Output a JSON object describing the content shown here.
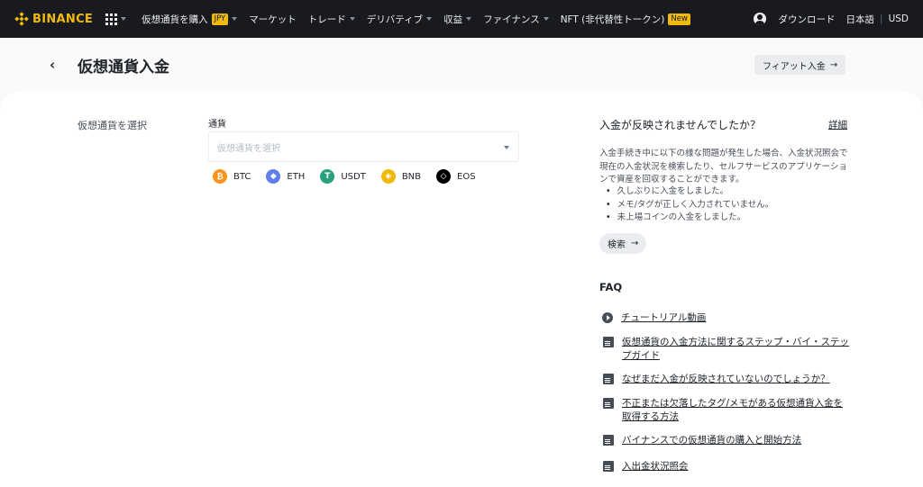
{
  "topbar": {
    "logo_text": "BINANCE",
    "brand_color": "#f0b90b",
    "nav": [
      {
        "label": "仮想通貨を購入",
        "badge": "JPY",
        "has_caret": true
      },
      {
        "label": "マーケット",
        "badge": "",
        "has_caret": false
      },
      {
        "label": "トレード",
        "badge": "",
        "has_caret": true
      },
      {
        "label": "デリバティブ",
        "badge": "",
        "has_caret": true
      },
      {
        "label": "収益",
        "badge": "",
        "has_caret": true
      },
      {
        "label": "ファイナンス",
        "badge": "",
        "has_caret": true
      },
      {
        "label": "NFT (非代替性トークン)",
        "badge": "New",
        "has_caret": false
      }
    ],
    "download_label": "ダウンロード",
    "language_label": "日本語",
    "currency_label": "USD"
  },
  "header": {
    "back_glyph": "‹",
    "title": "仮想通貨入金",
    "fiat_button_label": "フィアット入金",
    "arrow_glyph": "→"
  },
  "form": {
    "step_label": "仮想通貨を選択",
    "field_label": "通貨",
    "select_placeholder": "仮想通貨を選択",
    "coins": [
      {
        "symbol": "BTC",
        "icon": "bitcoin-icon",
        "color": "#f7931a",
        "glyph": "₿"
      },
      {
        "symbol": "ETH",
        "icon": "ethereum-icon",
        "color": "#627eea",
        "glyph": "◆"
      },
      {
        "symbol": "USDT",
        "icon": "tether-icon",
        "color": "#26a17b",
        "glyph": "T"
      },
      {
        "symbol": "BNB",
        "icon": "bnb-icon",
        "color": "#f0b90b",
        "glyph": "◈"
      },
      {
        "symbol": "EOS",
        "icon": "eos-icon",
        "color": "#000000",
        "glyph": "◇"
      }
    ]
  },
  "help": {
    "title": "入金が反映されませんでしたか？",
    "detail_link": "詳細",
    "description": "入金手続き中に以下の様な問題が発生した場合、入金状況照会で現在の入金状況を検索したり、セルフサービスのアプリケーションで資産を回収することができます。",
    "bullets": [
      "久しぶりに入金をしました。",
      "メモ/タグが正しく入力されていません。",
      "未上場コインの入金をしました。"
    ],
    "search_button_label": "検索"
  },
  "faq": {
    "title": "FAQ",
    "items": [
      {
        "label": "チュートリアル動画",
        "icon": "play-icon"
      },
      {
        "label": "仮想通貨の入金方法に関するステップ・バイ・ステップガイド",
        "icon": "document-icon"
      },
      {
        "label": "なぜまだ入金が反映されていないのでしょうか？",
        "icon": "document-icon"
      },
      {
        "label": "不正または欠落したタグ/メモがある仮想通貨入金を取得する方法",
        "icon": "document-icon"
      },
      {
        "label": "バイナンスでの仮想通貨の購入と開始方法",
        "icon": "document-icon"
      },
      {
        "label": "入出金状況照会",
        "icon": "document-icon"
      }
    ]
  }
}
